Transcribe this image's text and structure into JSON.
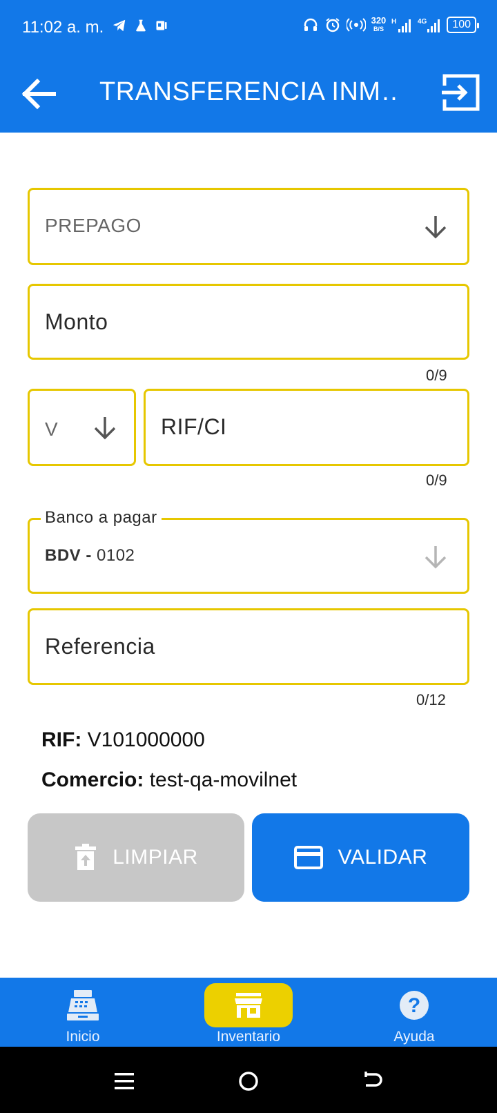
{
  "status_bar": {
    "time": "11:02 a. m.",
    "speed_value": "320",
    "speed_unit": "B/S",
    "network_h": "H",
    "network_4g": "4G",
    "battery": "100"
  },
  "app_bar": {
    "title": "TRANSFERENCIA INM…"
  },
  "form": {
    "product_select": {
      "value": "PREPAGO"
    },
    "amount": {
      "placeholder": "Monto",
      "counter": "0/9"
    },
    "id_type": {
      "value": "V"
    },
    "id_number": {
      "placeholder": "RIF/CI",
      "counter": "0/9"
    },
    "bank": {
      "label": "Banco a pagar",
      "code": "BDV -",
      "number": "0102"
    },
    "reference": {
      "placeholder": "Referencia",
      "counter": "0/12"
    }
  },
  "info": {
    "rif_label": "RIF:",
    "rif_value": "V101000000",
    "merchant_label": "Comercio:",
    "merchant_value": "test-qa-movilnet"
  },
  "buttons": {
    "clear_label": "LIMPIAR",
    "validate_label": "VALIDAR"
  },
  "bottom_nav": {
    "items": [
      {
        "label": "Inicio",
        "icon": "cash-register-icon"
      },
      {
        "label": "Inventario",
        "icon": "store-icon",
        "active": true
      },
      {
        "label": "Ayuda",
        "icon": "help-circle-icon"
      }
    ]
  },
  "colors": {
    "primary": "#1278e8",
    "field_border": "#e6c700",
    "active_nav": "#ecd000",
    "disabled_button": "#c7c7c7"
  }
}
